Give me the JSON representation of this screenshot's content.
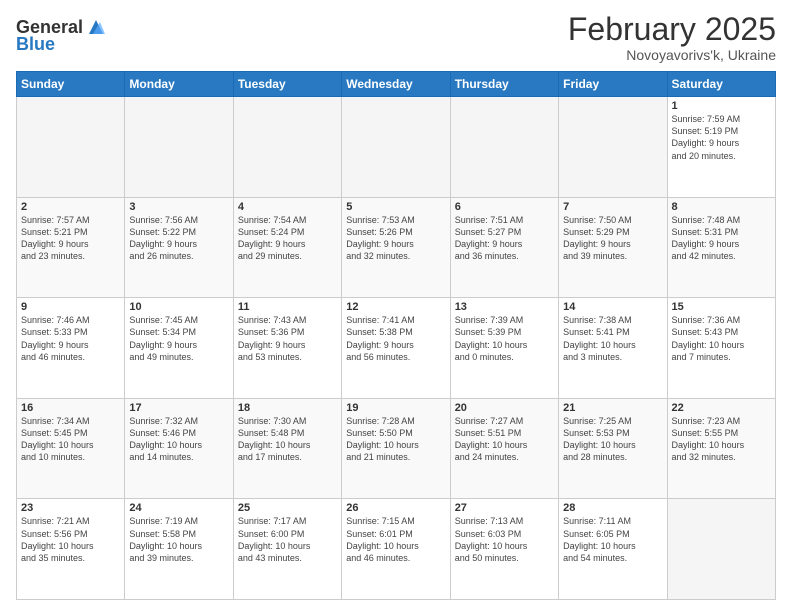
{
  "logo": {
    "text1": "General",
    "text2": "Blue"
  },
  "title": "February 2025",
  "subtitle": "Novoyavorivs'k, Ukraine",
  "weekdays": [
    "Sunday",
    "Monday",
    "Tuesday",
    "Wednesday",
    "Thursday",
    "Friday",
    "Saturday"
  ],
  "weeks": [
    [
      {
        "day": "",
        "info": ""
      },
      {
        "day": "",
        "info": ""
      },
      {
        "day": "",
        "info": ""
      },
      {
        "day": "",
        "info": ""
      },
      {
        "day": "",
        "info": ""
      },
      {
        "day": "",
        "info": ""
      },
      {
        "day": "1",
        "info": "Sunrise: 7:59 AM\nSunset: 5:19 PM\nDaylight: 9 hours\nand 20 minutes."
      }
    ],
    [
      {
        "day": "2",
        "info": "Sunrise: 7:57 AM\nSunset: 5:21 PM\nDaylight: 9 hours\nand 23 minutes."
      },
      {
        "day": "3",
        "info": "Sunrise: 7:56 AM\nSunset: 5:22 PM\nDaylight: 9 hours\nand 26 minutes."
      },
      {
        "day": "4",
        "info": "Sunrise: 7:54 AM\nSunset: 5:24 PM\nDaylight: 9 hours\nand 29 minutes."
      },
      {
        "day": "5",
        "info": "Sunrise: 7:53 AM\nSunset: 5:26 PM\nDaylight: 9 hours\nand 32 minutes."
      },
      {
        "day": "6",
        "info": "Sunrise: 7:51 AM\nSunset: 5:27 PM\nDaylight: 9 hours\nand 36 minutes."
      },
      {
        "day": "7",
        "info": "Sunrise: 7:50 AM\nSunset: 5:29 PM\nDaylight: 9 hours\nand 39 minutes."
      },
      {
        "day": "8",
        "info": "Sunrise: 7:48 AM\nSunset: 5:31 PM\nDaylight: 9 hours\nand 42 minutes."
      }
    ],
    [
      {
        "day": "9",
        "info": "Sunrise: 7:46 AM\nSunset: 5:33 PM\nDaylight: 9 hours\nand 46 minutes."
      },
      {
        "day": "10",
        "info": "Sunrise: 7:45 AM\nSunset: 5:34 PM\nDaylight: 9 hours\nand 49 minutes."
      },
      {
        "day": "11",
        "info": "Sunrise: 7:43 AM\nSunset: 5:36 PM\nDaylight: 9 hours\nand 53 minutes."
      },
      {
        "day": "12",
        "info": "Sunrise: 7:41 AM\nSunset: 5:38 PM\nDaylight: 9 hours\nand 56 minutes."
      },
      {
        "day": "13",
        "info": "Sunrise: 7:39 AM\nSunset: 5:39 PM\nDaylight: 10 hours\nand 0 minutes."
      },
      {
        "day": "14",
        "info": "Sunrise: 7:38 AM\nSunset: 5:41 PM\nDaylight: 10 hours\nand 3 minutes."
      },
      {
        "day": "15",
        "info": "Sunrise: 7:36 AM\nSunset: 5:43 PM\nDaylight: 10 hours\nand 7 minutes."
      }
    ],
    [
      {
        "day": "16",
        "info": "Sunrise: 7:34 AM\nSunset: 5:45 PM\nDaylight: 10 hours\nand 10 minutes."
      },
      {
        "day": "17",
        "info": "Sunrise: 7:32 AM\nSunset: 5:46 PM\nDaylight: 10 hours\nand 14 minutes."
      },
      {
        "day": "18",
        "info": "Sunrise: 7:30 AM\nSunset: 5:48 PM\nDaylight: 10 hours\nand 17 minutes."
      },
      {
        "day": "19",
        "info": "Sunrise: 7:28 AM\nSunset: 5:50 PM\nDaylight: 10 hours\nand 21 minutes."
      },
      {
        "day": "20",
        "info": "Sunrise: 7:27 AM\nSunset: 5:51 PM\nDaylight: 10 hours\nand 24 minutes."
      },
      {
        "day": "21",
        "info": "Sunrise: 7:25 AM\nSunset: 5:53 PM\nDaylight: 10 hours\nand 28 minutes."
      },
      {
        "day": "22",
        "info": "Sunrise: 7:23 AM\nSunset: 5:55 PM\nDaylight: 10 hours\nand 32 minutes."
      }
    ],
    [
      {
        "day": "23",
        "info": "Sunrise: 7:21 AM\nSunset: 5:56 PM\nDaylight: 10 hours\nand 35 minutes."
      },
      {
        "day": "24",
        "info": "Sunrise: 7:19 AM\nSunset: 5:58 PM\nDaylight: 10 hours\nand 39 minutes."
      },
      {
        "day": "25",
        "info": "Sunrise: 7:17 AM\nSunset: 6:00 PM\nDaylight: 10 hours\nand 43 minutes."
      },
      {
        "day": "26",
        "info": "Sunrise: 7:15 AM\nSunset: 6:01 PM\nDaylight: 10 hours\nand 46 minutes."
      },
      {
        "day": "27",
        "info": "Sunrise: 7:13 AM\nSunset: 6:03 PM\nDaylight: 10 hours\nand 50 minutes."
      },
      {
        "day": "28",
        "info": "Sunrise: 7:11 AM\nSunset: 6:05 PM\nDaylight: 10 hours\nand 54 minutes."
      },
      {
        "day": "",
        "info": ""
      }
    ]
  ]
}
